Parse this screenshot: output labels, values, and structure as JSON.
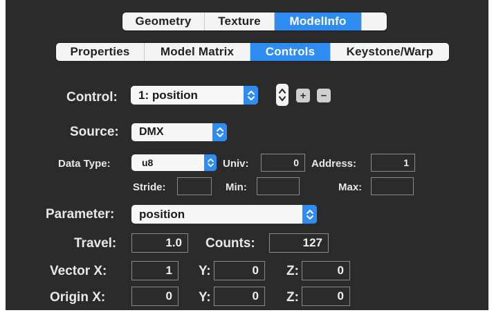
{
  "top_tabs": [
    "Geometry",
    "Texture",
    "ModelInfo"
  ],
  "sub_tabs": [
    "Properties",
    "Model Matrix",
    "Controls",
    "Keystone/Warp"
  ],
  "accent_color": "#2f8cf2",
  "control": {
    "label": "Control:",
    "value": "1: position",
    "add_label": "+",
    "remove_label": "−"
  },
  "source": {
    "label": "Source:",
    "value": "DMX"
  },
  "dmx": {
    "data_type_label": "Data Type:",
    "data_type_value": "u8",
    "univ_label": "Univ:",
    "univ_value": "0",
    "address_label": "Address:",
    "address_value": "1",
    "stride_label": "Stride:",
    "stride_value": "",
    "min_label": "Min:",
    "min_value": "",
    "max_label": "Max:",
    "max_value": ""
  },
  "parameter": {
    "label": "Parameter:",
    "value": "position"
  },
  "travel": {
    "label": "Travel:",
    "value": "1.0"
  },
  "counts": {
    "label": "Counts:",
    "value": "127"
  },
  "vector": {
    "x_label": "Vector X:",
    "x": "1",
    "y_label": "Y:",
    "y": "0",
    "z_label": "Z:",
    "z": "0"
  },
  "origin": {
    "x_label": "Origin X:",
    "x": "0",
    "y_label": "Y:",
    "y": "0",
    "z_label": "Z:",
    "z": "0"
  }
}
